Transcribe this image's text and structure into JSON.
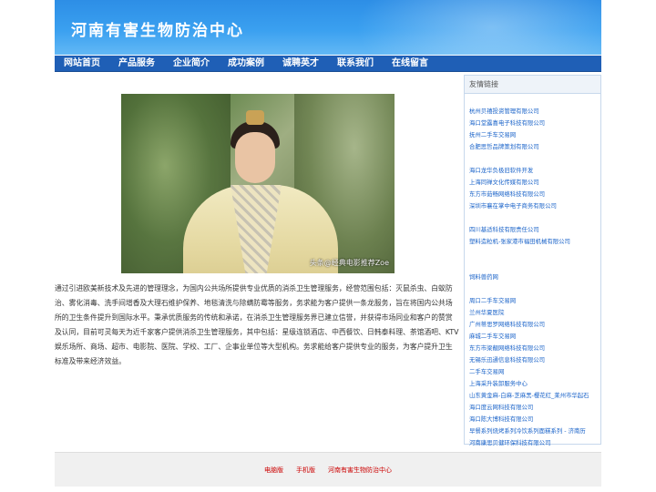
{
  "header": {
    "site_title": "河南有害生物防治中心"
  },
  "nav": {
    "items": [
      "网站首页",
      "产品服务",
      "企业简介",
      "成功案例",
      "诚聘英才",
      "联系我们",
      "在线留言"
    ]
  },
  "photo": {
    "caption": "头条@经典电影推荐Zoe"
  },
  "intro": {
    "text": "通过引进欧美新技术及先进的管理理念，为国内公共场所提供专业优质的消杀卫生管理服务，经营范围包括：灭鼠杀虫、白蚁防治、雾化消毒、洗手间增香及大理石维护保养、地毯清洗与除螨防霉等服务，务求能为客户提供一条龙服务，旨在将国内公共场所的卫生条件提升到国际水平。秉承优质服务的传统和承诺，在消杀卫生管理服务界已建立信誉，并获得市场同业和客户的赞赏及认同，目前可灵每天为近千家客户提供消杀卫生管理服务，其中包括：星级连锁酒店、中西餐饮、日韩泰料理、茶馆酒吧、KTV娱乐场所、商场、超市、电影院、医院、学校、工厂、企事业单位等大型机构。务求能给客户提供专业的服务，为客户提升卫生标准及带来经济效益。"
  },
  "sidebar": {
    "title": "友情链接",
    "group1": [
      "杭州贝禧投资管理有限公司",
      "海口堂露喜电子科技有限公司",
      "抚州二手车交易网",
      "合肥思哲品牌策划有限公司"
    ],
    "group2": [
      "海口龙华负极旧软件开发",
      "上海同禅文化传媒有限公司",
      "东方市茹畅网络科技有限公司",
      "深圳市襄在掌中电子商务有限公司"
    ],
    "group3": [
      "四川基适科技有限责任公司",
      "塑料造粒机-张家港市福田机械有限公司"
    ],
    "group4": [
      "饲料兽药网"
    ],
    "group5": [
      "周口二手车交易网",
      "兰州华夏医院",
      "广州蒂思罗网络科技有限公司",
      "麻城二手车交易网",
      "东方市梁靓网络科技有限公司",
      "无锡乐迅通信息科技有限公司",
      "二手车交易网",
      "上海采升装卸服务中心",
      "山东黄金麻-白麻-芝麻黑-樱花红_莱州市华起石",
      "海口度云网科技有限公司",
      "海口陈大博科技有限公司",
      "早餐系列烧烤系列冷饮系列面糕系列 - 济南历",
      "河南康思贝健环保科技有限公司"
    ]
  },
  "footer": {
    "links": [
      "电脑版",
      "手机版",
      "河南有害生物防治中心"
    ]
  },
  "colors": {
    "header_blue": "#3aa0f0",
    "nav_blue": "#1f5fb6",
    "link_blue": "#1a63c9",
    "footer_red": "#cc0000"
  }
}
